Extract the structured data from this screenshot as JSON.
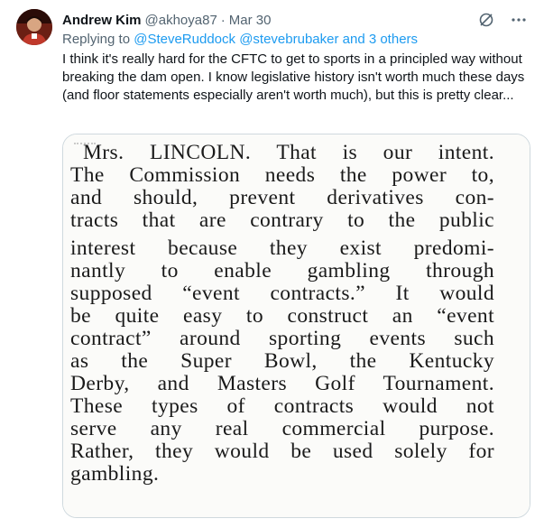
{
  "author": {
    "name": "Andrew Kim",
    "handle": "@akhoya87",
    "separator": "·",
    "date": "Mar 30"
  },
  "header_icons": [
    "grok-icon",
    "more-icon"
  ],
  "replying": {
    "prefix": "Replying to",
    "mention1": "@SteveRuddock",
    "mention2": "@stevebrubaker",
    "others": "and 3 others"
  },
  "tweet": {
    "text": "I think it's really hard for the CFTC to get to sports in a principled way without breaking the dam open.  I know legislative history isn't worth much these days (and floor statements especially aren't worth much), but this is pretty clear..."
  },
  "media": {
    "lines": [
      "Mrs. LINCOLN. That is our intent.",
      "The Commission needs the power to,",
      "and should, prevent derivatives con-",
      "tracts that are contrary to the public",
      "interest because they exist predomi-",
      "nantly to enable gambling through",
      "supposed “event contracts.” It would",
      "be quite easy to construct an “event",
      "contract” around sporting events such",
      "as the Super Bowl, the Kentucky",
      "Derby, and Masters Golf Tournament.",
      "These types of contracts would not",
      "serve any real commercial purpose.",
      "Rather, they would be used solely for",
      "gambling."
    ]
  },
  "colors": {
    "text": "#0f1419",
    "secondary": "#536471",
    "link": "#1d9bf0",
    "border": "#cfd9de"
  }
}
